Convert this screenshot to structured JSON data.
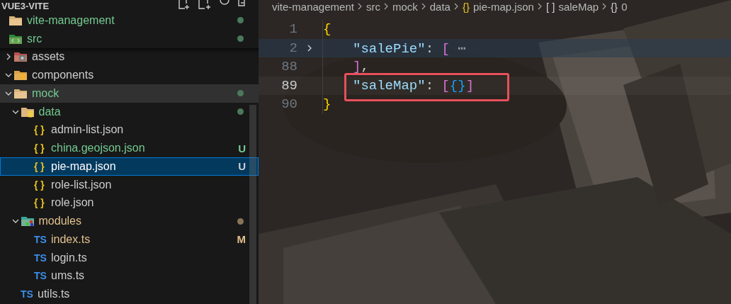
{
  "explorer": {
    "title": "VUE3-VITE",
    "tree": [
      {
        "name": "vite-management",
        "kind": "folder",
        "color": "#73c991",
        "dot": true,
        "selected": false,
        "hovered": false,
        "children": [
          {
            "name": "src",
            "kind": "source-folder",
            "color": "#73c991",
            "dot": true,
            "selected": false,
            "hovered": false,
            "children": [
              {
                "name": "assets",
                "kind": "assets-folder",
                "expanded": false,
                "selected": false,
                "hovered": false
              },
              {
                "name": "components",
                "kind": "components-folder",
                "expanded": true,
                "selected": false,
                "hovered": false
              },
              {
                "name": "mock",
                "kind": "folder",
                "expanded": true,
                "color": "#73c991",
                "dot": true,
                "selected": false,
                "hovered": true,
                "children": [
                  {
                    "name": "data",
                    "kind": "data-folder",
                    "expanded": true,
                    "color": "#73c991",
                    "dot": true,
                    "selected": false,
                    "hovered": false,
                    "children": [
                      {
                        "name": "admin-list.json",
                        "kind": "json",
                        "icon_label": "{ }",
                        "selected": false,
                        "hovered": false
                      },
                      {
                        "name": "china.geojson.json",
                        "kind": "json",
                        "icon_label": "{ }",
                        "color": "#73c991",
                        "badge": "U",
                        "selected": false,
                        "hovered": false
                      },
                      {
                        "name": "pie-map.json",
                        "kind": "json",
                        "icon_label": "{ }",
                        "badge": "U",
                        "selected": true,
                        "hovered": false
                      },
                      {
                        "name": "role-list.json",
                        "kind": "json",
                        "icon_label": "{ }",
                        "selected": false,
                        "hovered": false
                      },
                      {
                        "name": "role.json",
                        "kind": "json",
                        "icon_label": "{ }",
                        "selected": false,
                        "hovered": false
                      }
                    ]
                  },
                  {
                    "name": "modules",
                    "kind": "modules-folder",
                    "expanded": true,
                    "color": "#e2c08d",
                    "dot": true,
                    "selected": false,
                    "hovered": false,
                    "children": [
                      {
                        "name": "index.ts",
                        "kind": "ts",
                        "icon_label": "TS",
                        "color": "#e2c08d",
                        "badge": "M",
                        "selected": false,
                        "hovered": false
                      },
                      {
                        "name": "login.ts",
                        "kind": "ts",
                        "icon_label": "TS",
                        "selected": false,
                        "hovered": false
                      },
                      {
                        "name": "ums.ts",
                        "kind": "ts",
                        "icon_label": "TS",
                        "selected": false,
                        "hovered": false
                      }
                    ]
                  }
                ]
              },
              {
                "name": "utils.ts",
                "kind": "ts",
                "icon_label": "TS",
                "selected": false,
                "hovered": false
              }
            ]
          }
        ]
      }
    ]
  },
  "editor": {
    "breadcrumbs": [
      {
        "label": "vite-management"
      },
      {
        "label": "src"
      },
      {
        "label": "mock"
      },
      {
        "label": "data"
      },
      {
        "label": "pie-map.json",
        "icon_label": "{}",
        "kind": "json"
      },
      {
        "label": "saleMap",
        "icon_label": "[ ]",
        "kind": "array"
      },
      {
        "label": "0",
        "icon_label": "{}",
        "kind": "object"
      }
    ],
    "lines": [
      {
        "number": "1",
        "current": false,
        "folded": false,
        "boxed": false,
        "tokens": [
          {
            "kind": "brace",
            "text": "{"
          }
        ],
        "children": [
          {
            "number": "2",
            "current": false,
            "folded": true,
            "boxed": false,
            "tokens": [
              {
                "kind": "key",
                "text": "\"salePie\""
              },
              {
                "kind": "punct",
                "text": ": "
              },
              {
                "kind": "bracket",
                "text": "["
              },
              {
                "kind": "ellipsis",
                "text": " ⋯"
              }
            ]
          },
          {
            "number": "88",
            "current": false,
            "folded": false,
            "boxed": false,
            "tokens": [
              {
                "kind": "bracket",
                "text": "]"
              },
              {
                "kind": "punct",
                "text": ","
              }
            ]
          },
          {
            "number": "89",
            "current": true,
            "folded": false,
            "boxed": true,
            "tokens": [
              {
                "kind": "key",
                "text": "\"saleMap\""
              },
              {
                "kind": "punct",
                "text": ": "
              },
              {
                "kind": "bracket",
                "text": "["
              },
              {
                "kind": "inner",
                "text": "{}"
              },
              {
                "kind": "bracket",
                "text": "]"
              }
            ]
          }
        ]
      },
      {
        "number": "90",
        "current": false,
        "folded": false,
        "boxed": false,
        "tokens": [
          {
            "kind": "brace",
            "text": "}"
          }
        ]
      }
    ]
  }
}
